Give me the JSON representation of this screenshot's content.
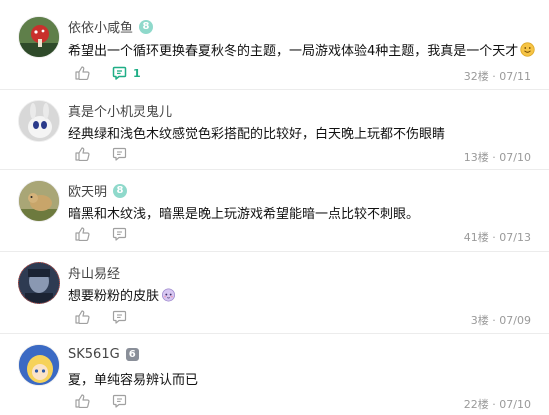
{
  "comments": [
    {
      "user": "依依小咸鱼",
      "level": "8",
      "text": "希望出一个循环更换春夏秋冬的主题，一局游戏体验4种主题，我真是一个天才",
      "emoji": "smile-emoji",
      "reply_count": "1",
      "floor": "32楼",
      "date": "07/11",
      "avatar_bg": "#4b6a3e"
    },
    {
      "user": "真是个小机灵鬼儿",
      "level": "",
      "text": "经典绿和浅色木纹感觉色彩搭配的比较好，白天晚上玩都不伤眼睛",
      "floor": "13楼",
      "date": "07/10",
      "avatar_bg": "#cfcfcf"
    },
    {
      "user": "欧天明",
      "level": "8",
      "text": "暗黑和木纹浅，暗黑是晚上玩游戏希望能暗一点比较不刺眼。",
      "floor": "41楼",
      "date": "07/13",
      "avatar_bg": "#8a8a5a"
    },
    {
      "user": "舟山易经",
      "level": "",
      "text": "想要粉粉的皮肤",
      "emoji": "cute-face-emoji",
      "floor": "3楼",
      "date": "07/09",
      "avatar_bg": "#3a4a63"
    },
    {
      "user": "SK561G",
      "level": "6",
      "text": "夏，单纯容易辨认而已",
      "floor": "22楼",
      "date": "07/10",
      "avatar_bg": "#2f5aa8"
    }
  ],
  "separator": "·",
  "colors": {
    "accent": "#1fae86",
    "meta": "#9a9a9a",
    "icon": "#a0a0a0"
  }
}
